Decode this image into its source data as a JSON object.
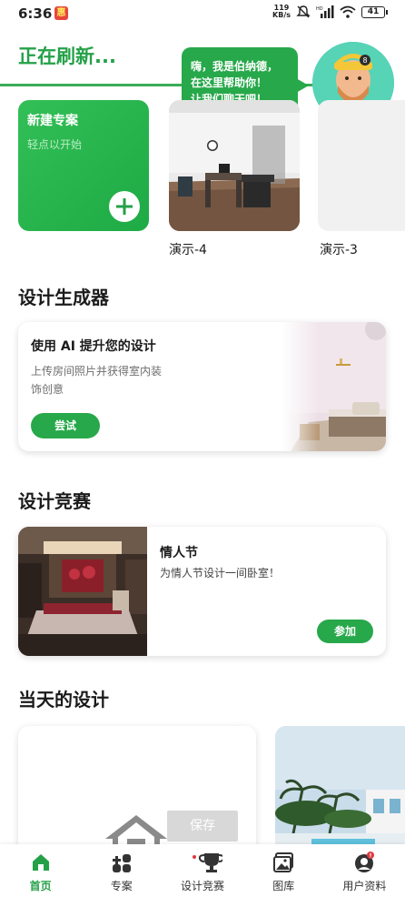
{
  "status_bar": {
    "time": "6:36",
    "app_badge": "惠",
    "net_speed_value": "119",
    "net_speed_unit": "KB/s",
    "battery": "41"
  },
  "header": {
    "refresh_title": "正在刷新..."
  },
  "assistant": {
    "speech_lines": [
      "嗨，我是伯纳德，",
      "在这里帮助你！",
      "让我们聊天吧！"
    ]
  },
  "projects": {
    "new_title": "新建专案",
    "new_subtitle": "轻点以开始",
    "items": [
      {
        "label": "演示-4"
      },
      {
        "label": "演示-3"
      }
    ]
  },
  "design_generator": {
    "section_title": "设计生成器",
    "card_title": "使用 AI 提升您的设计",
    "card_desc": "上传房间照片并获得室内装饰创意",
    "button": "尝试"
  },
  "competition": {
    "section_title": "设计竞赛",
    "card_title": "情人节",
    "card_desc": "为情人节设计一间卧室！",
    "button": "参加"
  },
  "daily_design": {
    "section_title": "当天的设计",
    "save_label": "保存"
  },
  "bottom_nav": {
    "items": [
      {
        "label": "首页",
        "icon": "home-icon",
        "active": true
      },
      {
        "label": "专案",
        "icon": "projects-icon",
        "active": false
      },
      {
        "label": "设计竞赛",
        "icon": "trophy-icon",
        "active": false
      },
      {
        "label": "图库",
        "icon": "gallery-icon",
        "active": false
      },
      {
        "label": "用户资料",
        "icon": "profile-icon",
        "active": false
      }
    ]
  },
  "colors": {
    "accent": "#27a84a",
    "accent_dark": "#24a148"
  }
}
